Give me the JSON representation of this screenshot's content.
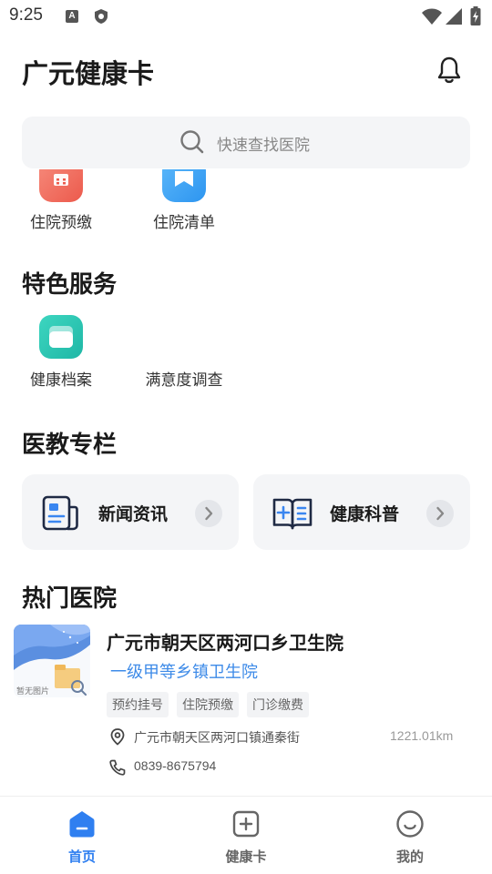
{
  "status_bar": {
    "time": "9:25",
    "icons": [
      "a-badge-icon",
      "shield-icon",
      "wifi-icon",
      "signal-icon",
      "battery-icon"
    ]
  },
  "header": {
    "title": "广元健康卡",
    "bell_icon": "bell-icon"
  },
  "search": {
    "placeholder": "快速查找医院"
  },
  "quick_services": [
    {
      "label": "住院预缴",
      "icon": "calendar-icon",
      "color": "#f26b5b"
    },
    {
      "label": "住院清单",
      "icon": "bookmark-list-icon",
      "color": "#3aa2f5"
    }
  ],
  "featured": {
    "title": "特色服务",
    "items": [
      {
        "label": "健康档案",
        "icon": "folder-icon",
        "color": "#2ec4b2"
      },
      {
        "label": "满意度调查",
        "icon": ""
      }
    ]
  },
  "edu": {
    "title": "医教专栏",
    "cards": [
      {
        "label": "新闻资讯",
        "icon": "news-icon"
      },
      {
        "label": "健康科普",
        "icon": "book-plus-icon"
      }
    ]
  },
  "hot_hospitals": {
    "title": "热门医院",
    "items": [
      {
        "name": "广元市朝天区两河口乡卫生院",
        "level": "一级甲等乡镇卫生院",
        "tags": [
          "预约挂号",
          "住院预缴",
          "门诊缴费"
        ],
        "address": "广元市朝天区两河口镇通秦街",
        "distance": "1221.01km",
        "phone": "0839-8675794",
        "thumb_caption": "暂无图片"
      }
    ]
  },
  "tabbar": {
    "tabs": [
      {
        "label": "首页",
        "icon": "home-icon",
        "active": true
      },
      {
        "label": "健康卡",
        "icon": "plus-card-icon",
        "active": false
      },
      {
        "label": "我的",
        "icon": "smile-icon",
        "active": false
      }
    ],
    "active_color": "#2f7ff0",
    "inactive_color": "#666666"
  }
}
